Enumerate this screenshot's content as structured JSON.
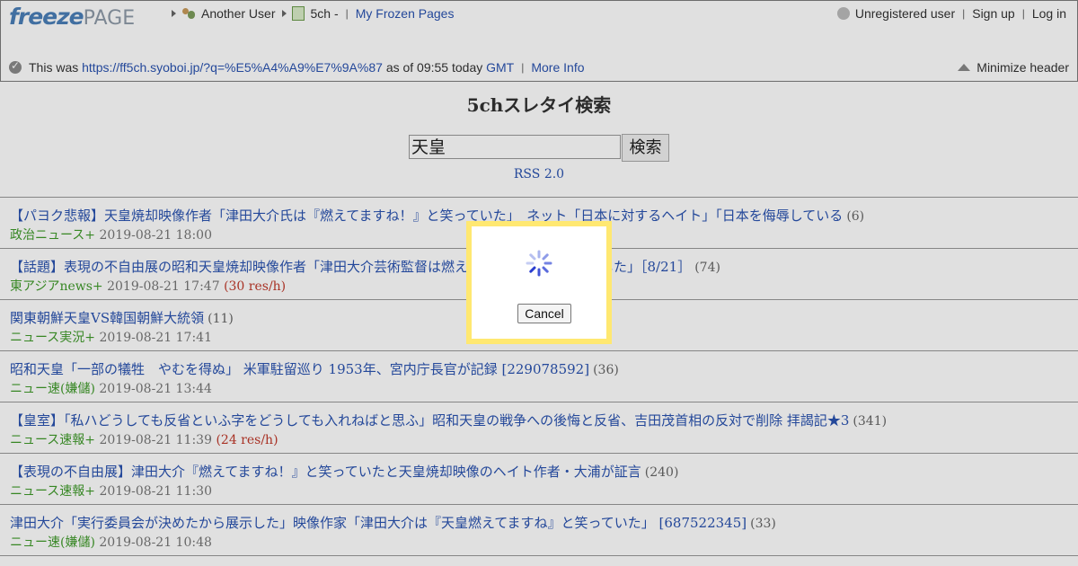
{
  "header": {
    "logo": {
      "freeze": "freeze",
      "page": "PAGE"
    },
    "breadcrumbs": {
      "user": "Another User",
      "page": "5ch -",
      "my_pages": "My Frozen Pages"
    },
    "user_area": {
      "status": "Unregistered user",
      "signup": "Sign up",
      "login": "Log in"
    },
    "info": {
      "prefix": "This was",
      "url": "https://ff5ch.syoboi.jp/?q=%E5%A4%A9%E7%9A%87",
      "as_of": "as of 09:55 today",
      "tz": "GMT",
      "more": "More Info"
    },
    "minimize": "Minimize header"
  },
  "page": {
    "title": "5chスレタイ検索",
    "search": {
      "value": "天皇",
      "button": "検索"
    },
    "rss": "RSS 2.0"
  },
  "results": [
    {
      "title": "【パヨク悲報】天皇焼却映像作者「津田大介氏は『燃えてますね！』と笑っていた」　ネット「日本に対するヘイト」「日本を侮辱している",
      "count": "(6)",
      "board": "政治ニュース+",
      "date": "2019-08-21 18:00",
      "rate": ""
    },
    {
      "title": "【話題】表現の不自由展の昭和天皇焼却映像作者「津田大介芸術監督は燃えてますね！と笑ってました」［8/21］",
      "count": "(74)",
      "board": "東アジアnews+",
      "date": "2019-08-21 17:47",
      "rate": "(30 res/h)"
    },
    {
      "title": "関東朝鮮天皇VS韓国朝鮮大統領",
      "count": "(11)",
      "board": "ニュース実況+",
      "date": "2019-08-21 17:41",
      "rate": ""
    },
    {
      "title": "昭和天皇「一部の犠牲　やむを得ぬ」 米軍駐留巡り 1953年、宮内庁長官が記録 [229078592]",
      "count": "(36)",
      "board": "ニュー速(嫌儲)",
      "date": "2019-08-21 13:44",
      "rate": ""
    },
    {
      "title": "【皇室】「私ハどうしても反省といふ字をどうしても入れねばと思ふ」昭和天皇の戦争への後悔と反省、吉田茂首相の反対で削除 拝謁記★3",
      "count": "(341)",
      "board": "ニュース速報+",
      "date": "2019-08-21 11:39",
      "rate": "(24 res/h)"
    },
    {
      "title": "【表現の不自由展】津田大介『燃えてますね！』と笑っていたと天皇焼却映像のヘイト作者・大浦が証言",
      "count": "(240)",
      "board": "ニュース速報+",
      "date": "2019-08-21 11:30",
      "rate": ""
    },
    {
      "title": "津田大介「実行委員会が決めたから展示した」映像作家「津田大介は『天皇燃えてますね』と笑っていた」 [687522345]",
      "count": "(33)",
      "board": "ニュー速(嫌儲)",
      "date": "2019-08-21 10:48",
      "rate": ""
    }
  ],
  "modal": {
    "cancel": "Cancel"
  },
  "colors": {
    "accent_link": "#2a53b0",
    "board_green": "#3f9a2a",
    "modal_border": "#ffe871"
  },
  "icons": [
    "users-icon",
    "page-icon",
    "user-icon",
    "check-icon",
    "triangle-up-icon",
    "spinner-icon"
  ]
}
